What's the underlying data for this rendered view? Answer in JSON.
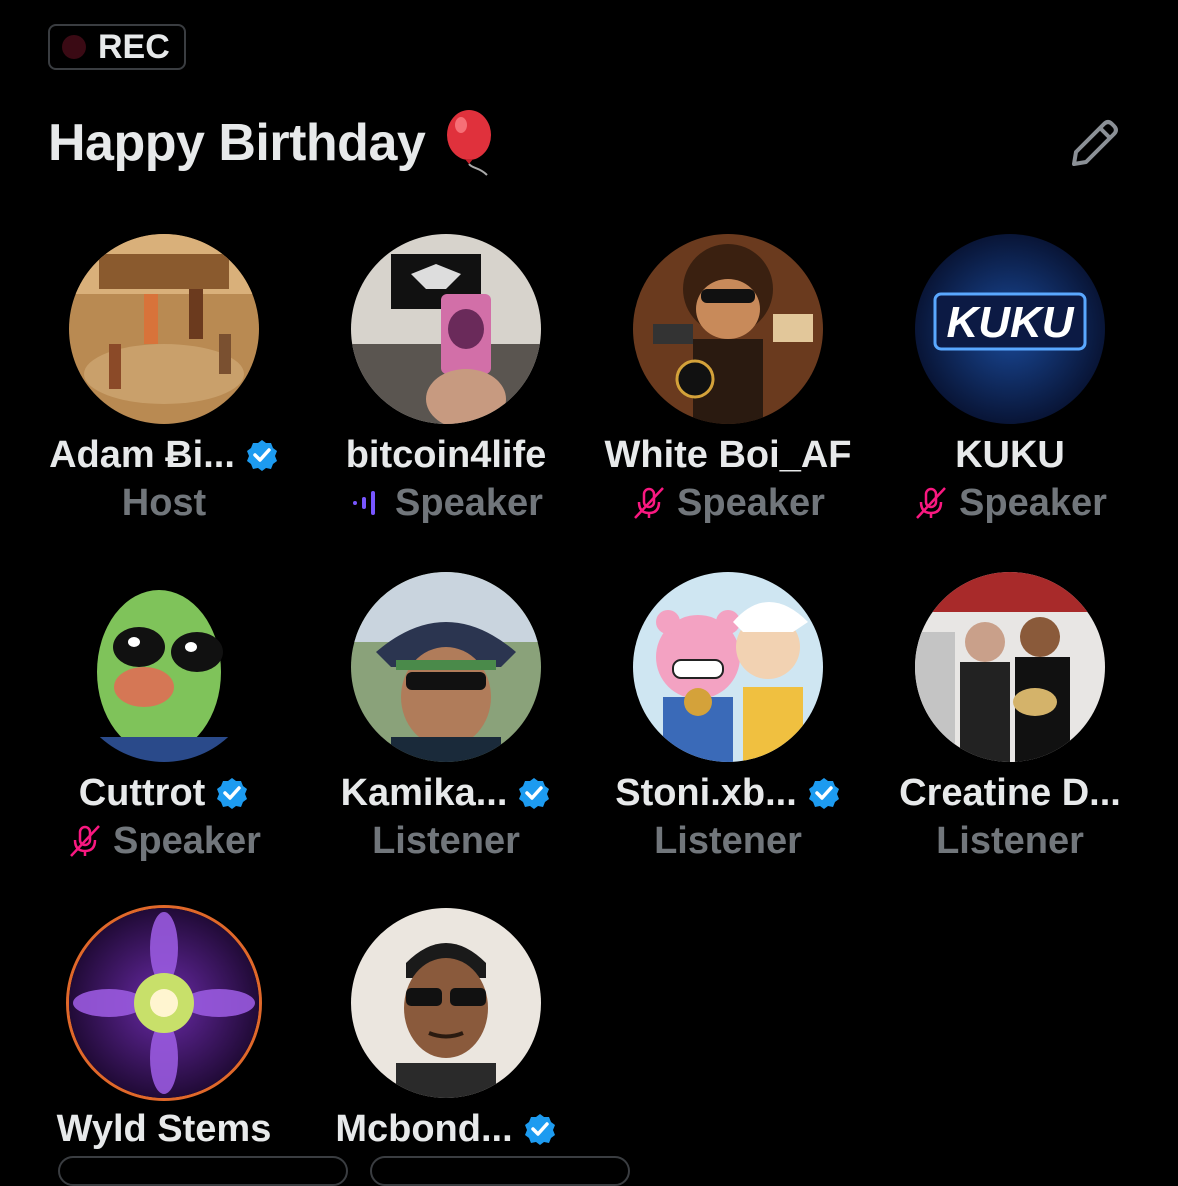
{
  "rec": {
    "label": "REC"
  },
  "space": {
    "title": "Happy Birthday",
    "title_emoji": "balloon-icon"
  },
  "participants": [
    {
      "name": "Adam Ƀi...",
      "role": "Host",
      "verified": true,
      "status_icon": null
    },
    {
      "name": "bitcoin4life",
      "role": "Speaker",
      "verified": false,
      "status_icon": "speaking-bars-icon"
    },
    {
      "name": "White Boi_AF",
      "role": "Speaker",
      "verified": false,
      "status_icon": "mic-muted-icon"
    },
    {
      "name": "KUKU",
      "role": "Speaker",
      "verified": false,
      "status_icon": "mic-muted-icon",
      "avatar_text": "KUKU"
    },
    {
      "name": "Cuttrot",
      "role": "Speaker",
      "verified": true,
      "status_icon": "mic-muted-icon"
    },
    {
      "name": "Kamika...",
      "role": "Listener",
      "verified": true,
      "status_icon": null
    },
    {
      "name": "Stoni.xb...",
      "role": "Listener",
      "verified": true,
      "status_icon": null
    },
    {
      "name": "Creatine D...",
      "role": "Listener",
      "verified": false,
      "status_icon": null
    },
    {
      "name": "Wyld Stems",
      "role": "",
      "verified": false,
      "status_icon": null
    },
    {
      "name": "Mcbond...",
      "role": "",
      "verified": true,
      "status_icon": null
    }
  ],
  "colors": {
    "verified": "#1d9bf0",
    "muted": "#f91880",
    "speaking": "#7856ff",
    "role_text": "#71767b"
  }
}
